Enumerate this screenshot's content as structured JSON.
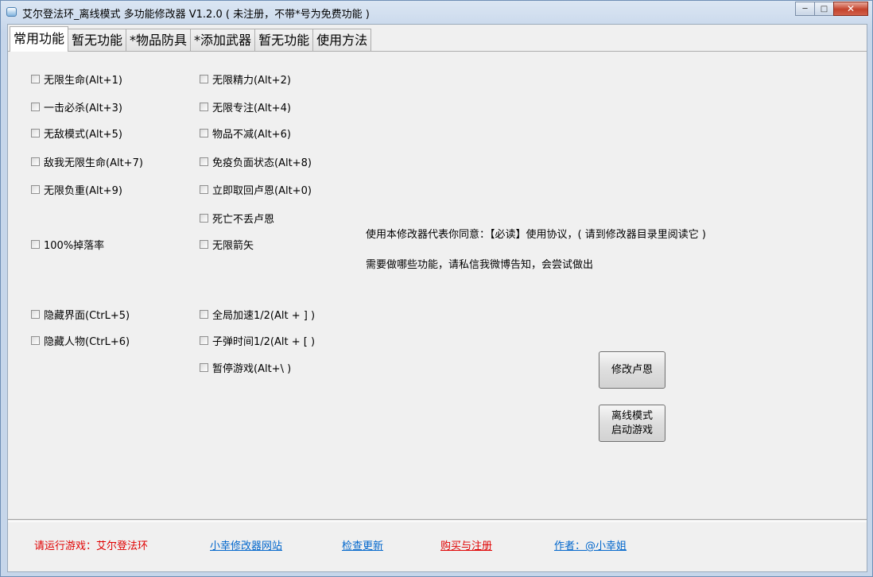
{
  "window": {
    "title": "艾尔登法环_离线模式 多功能修改器  V1.2.0 ( 未注册，不带*号为免费功能 )"
  },
  "tabs": [
    {
      "label": "常用功能"
    },
    {
      "label": "暂无功能"
    },
    {
      "label": "*物品防具"
    },
    {
      "label": "*添加武器"
    },
    {
      "label": "暂无功能"
    },
    {
      "label": "使用方法"
    }
  ],
  "options_left": [
    {
      "label": "无限生命(Alt+1)"
    },
    {
      "label": "一击必杀(Alt+3)"
    },
    {
      "label": "无敌模式(Alt+5)"
    },
    {
      "label": "敌我无限生命(Alt+7)"
    },
    {
      "label": "无限负重(Alt+9)"
    },
    {
      "label": "100%掉落率"
    },
    {
      "label": "隐藏界面(CtrL+5)"
    },
    {
      "label": "隐藏人物(CtrL+6)"
    }
  ],
  "options_right": [
    {
      "label": "无限精力(Alt+2)"
    },
    {
      "label": "无限专注(Alt+4)"
    },
    {
      "label": "物品不减(Alt+6)"
    },
    {
      "label": "免疫负面状态(Alt+8)"
    },
    {
      "label": "立即取回卢恩(Alt+0)"
    },
    {
      "label": "死亡不丢卢恩"
    },
    {
      "label": "无限箭矢"
    },
    {
      "label": "全局加速1/2(Alt + ] )"
    },
    {
      "label": "子弹时间1/2(Alt + [ )"
    },
    {
      "label": "暂停游戏(Alt+\\ )"
    }
  ],
  "info": {
    "line1": "使用本修改器代表你同意：【必读】使用协议，( 请到修改器目录里阅读它 )",
    "line2": "需要做哪些功能，请私信我微博告知，会尝试做出"
  },
  "buttons": {
    "modify_runes": "修改卢恩",
    "offline_line1": "离线模式",
    "offline_line2": "启动游戏"
  },
  "footer": {
    "status": "请运行游戏：艾尔登法环",
    "website": "小幸修改器网站",
    "check_update": "检查更新",
    "buy_register": "购买与注册",
    "author": "作者：@小幸姐"
  },
  "colors": {
    "status_red": "#e00000",
    "link_blue": "#0066cc"
  }
}
